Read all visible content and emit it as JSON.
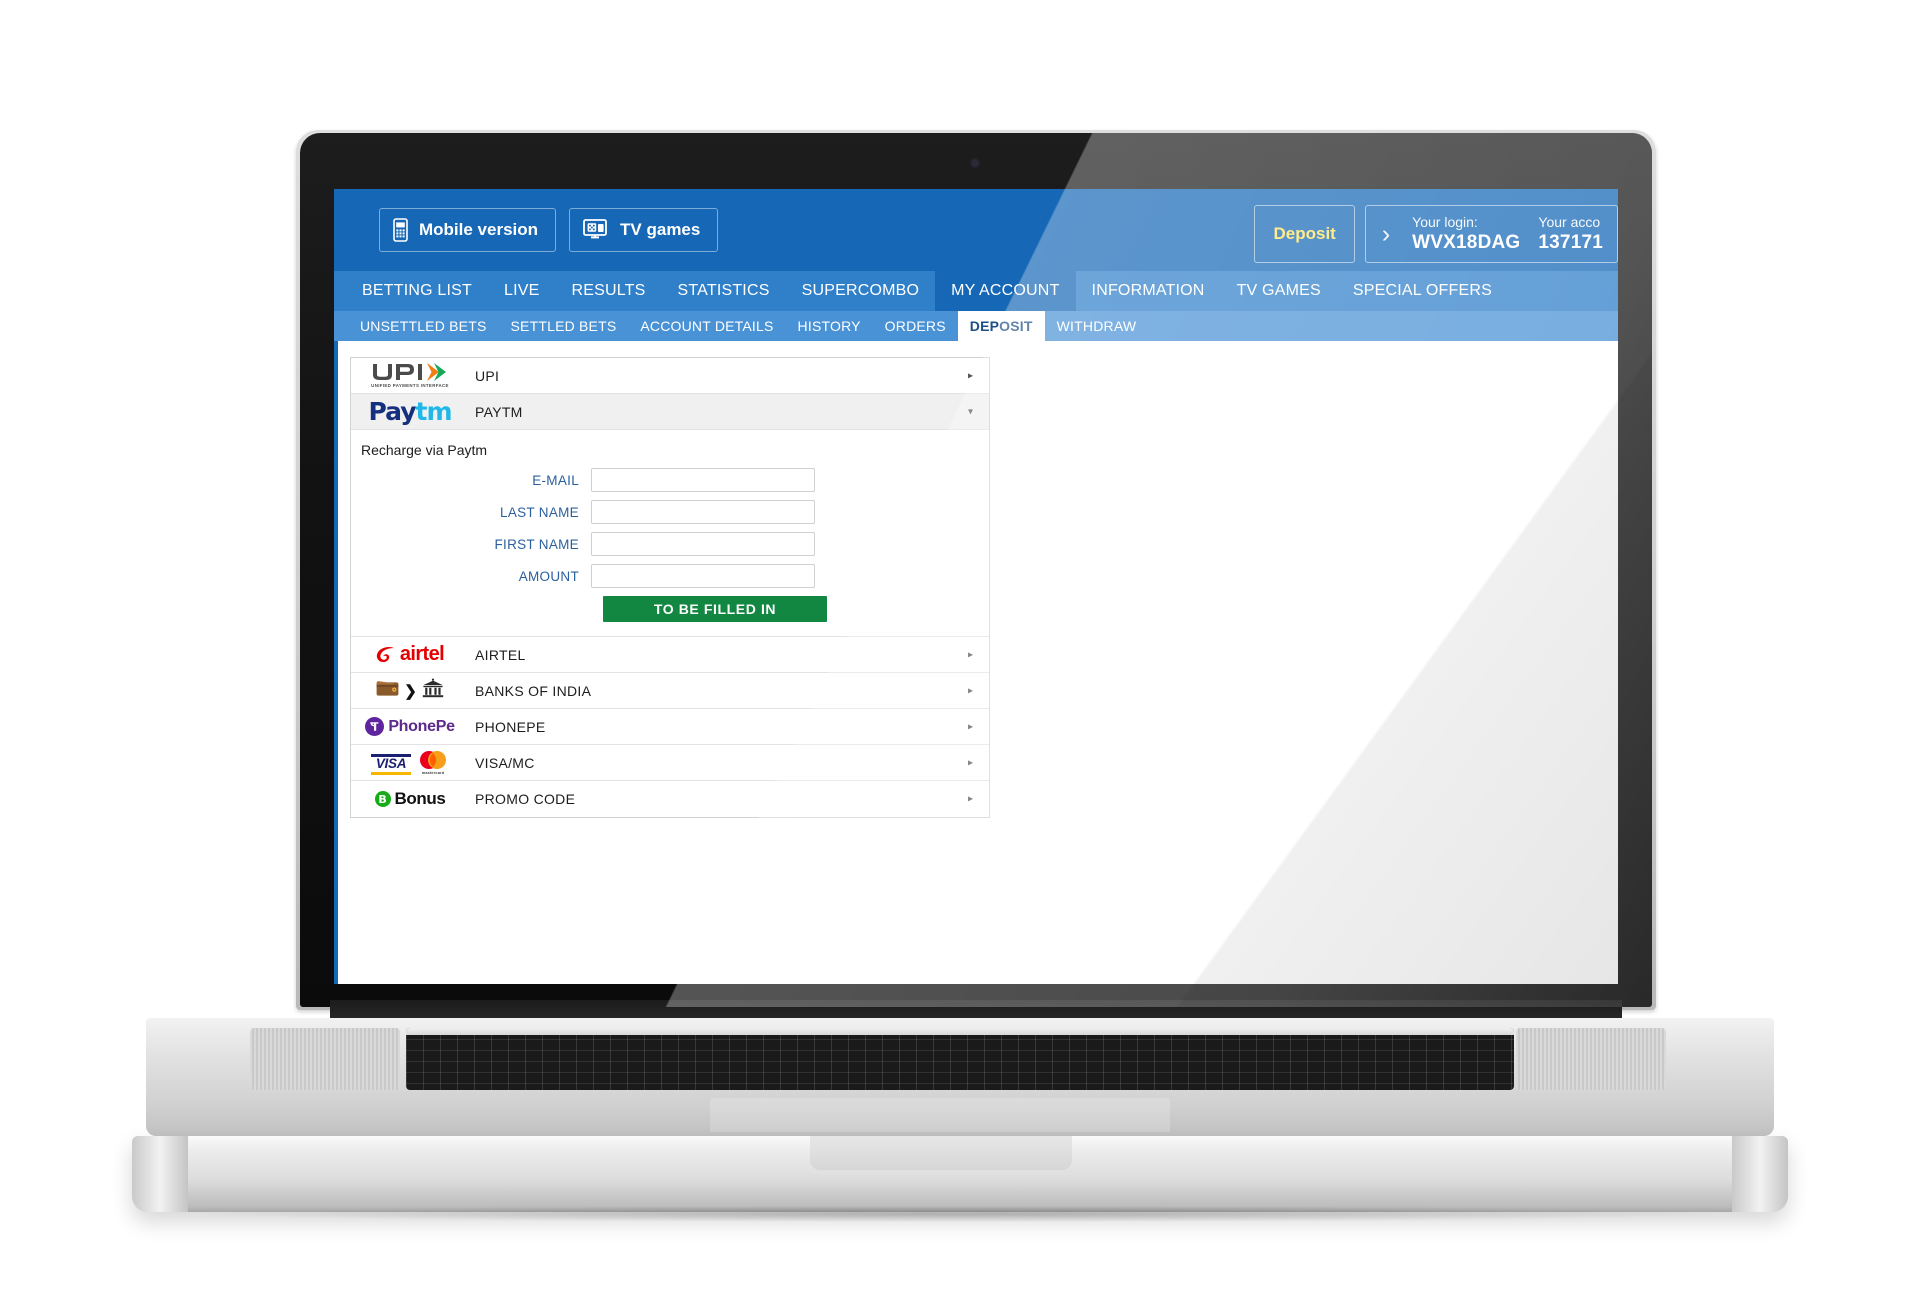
{
  "topbar": {
    "buttons": [
      {
        "label": "Mobile version",
        "icon": "mobile-phone-icon"
      },
      {
        "label": "TV games",
        "icon": "tv-dice-icon"
      }
    ],
    "deposit_label": "Deposit",
    "account": {
      "login_caption": "Your login:",
      "login_value": "WVX18DAG",
      "account_caption": "Your acco",
      "account_value": "137171"
    }
  },
  "mainnav": {
    "items": [
      {
        "label": "BETTING LIST",
        "active": false
      },
      {
        "label": "LIVE",
        "active": false
      },
      {
        "label": "RESULTS",
        "active": false
      },
      {
        "label": "STATISTICS",
        "active": false
      },
      {
        "label": "SUPERCOMBO",
        "active": false
      },
      {
        "label": "MY ACCOUNT",
        "active": true
      },
      {
        "label": "INFORMATION",
        "active": false
      },
      {
        "label": "TV GAMES",
        "active": false
      },
      {
        "label": "SPECIAL OFFERS",
        "active": false
      }
    ]
  },
  "subnav": {
    "items": [
      {
        "label": "UNSETTLED BETS",
        "active": false
      },
      {
        "label": "SETTLED BETS",
        "active": false
      },
      {
        "label": "ACCOUNT DETAILS",
        "active": false
      },
      {
        "label": "HISTORY",
        "active": false
      },
      {
        "label": "ORDERS",
        "active": false
      },
      {
        "label": "DEPOSIT",
        "active": true
      },
      {
        "label": "WITHDRAW",
        "active": false
      }
    ]
  },
  "payment_methods": {
    "upi": {
      "label": "UPI",
      "logo_text": "UPI",
      "logo_sub": "UNIFIED PAYMENTS INTERFACE",
      "arrow": "▸"
    },
    "paytm": {
      "label": "PAYTM",
      "logo_part1": "Pay",
      "logo_part2": "tm",
      "arrow": "▾"
    },
    "airtel": {
      "label": "AIRTEL",
      "logo_text": "airtel",
      "arrow": "▸"
    },
    "banks": {
      "label": "BANKS OF INDIA",
      "chevron": "❯",
      "arrow": "▸"
    },
    "phonepe": {
      "label": "PHONEPE",
      "logo_text": "PhonePe",
      "arrow": "▸"
    },
    "visamc": {
      "label": "VISA/MC",
      "visa_text": "VISA",
      "mc_text": "mastercard",
      "arrow": "▸"
    },
    "promo": {
      "label": "PROMO CODE",
      "badge": "B",
      "logo_text": "Bonus",
      "arrow": "▸"
    }
  },
  "paytm_form": {
    "title": "Recharge via Paytm",
    "fields": [
      {
        "label": "E-MAIL",
        "value": "",
        "placeholder": ""
      },
      {
        "label": "LAST NAME",
        "value": "",
        "placeholder": ""
      },
      {
        "label": "FIRST NAME",
        "value": "",
        "placeholder": ""
      },
      {
        "label": "AMOUNT",
        "value": "",
        "placeholder": ""
      }
    ],
    "submit_label": "TO BE FILLED IN"
  },
  "colors": {
    "header_blue": "#1668b7",
    "nav_blue": "#2f7fc9",
    "subnav_blue": "#4a92d6",
    "accent_yellow": "#ffe45e",
    "submit_green": "#128742",
    "label_blue": "#2b5f9e"
  }
}
